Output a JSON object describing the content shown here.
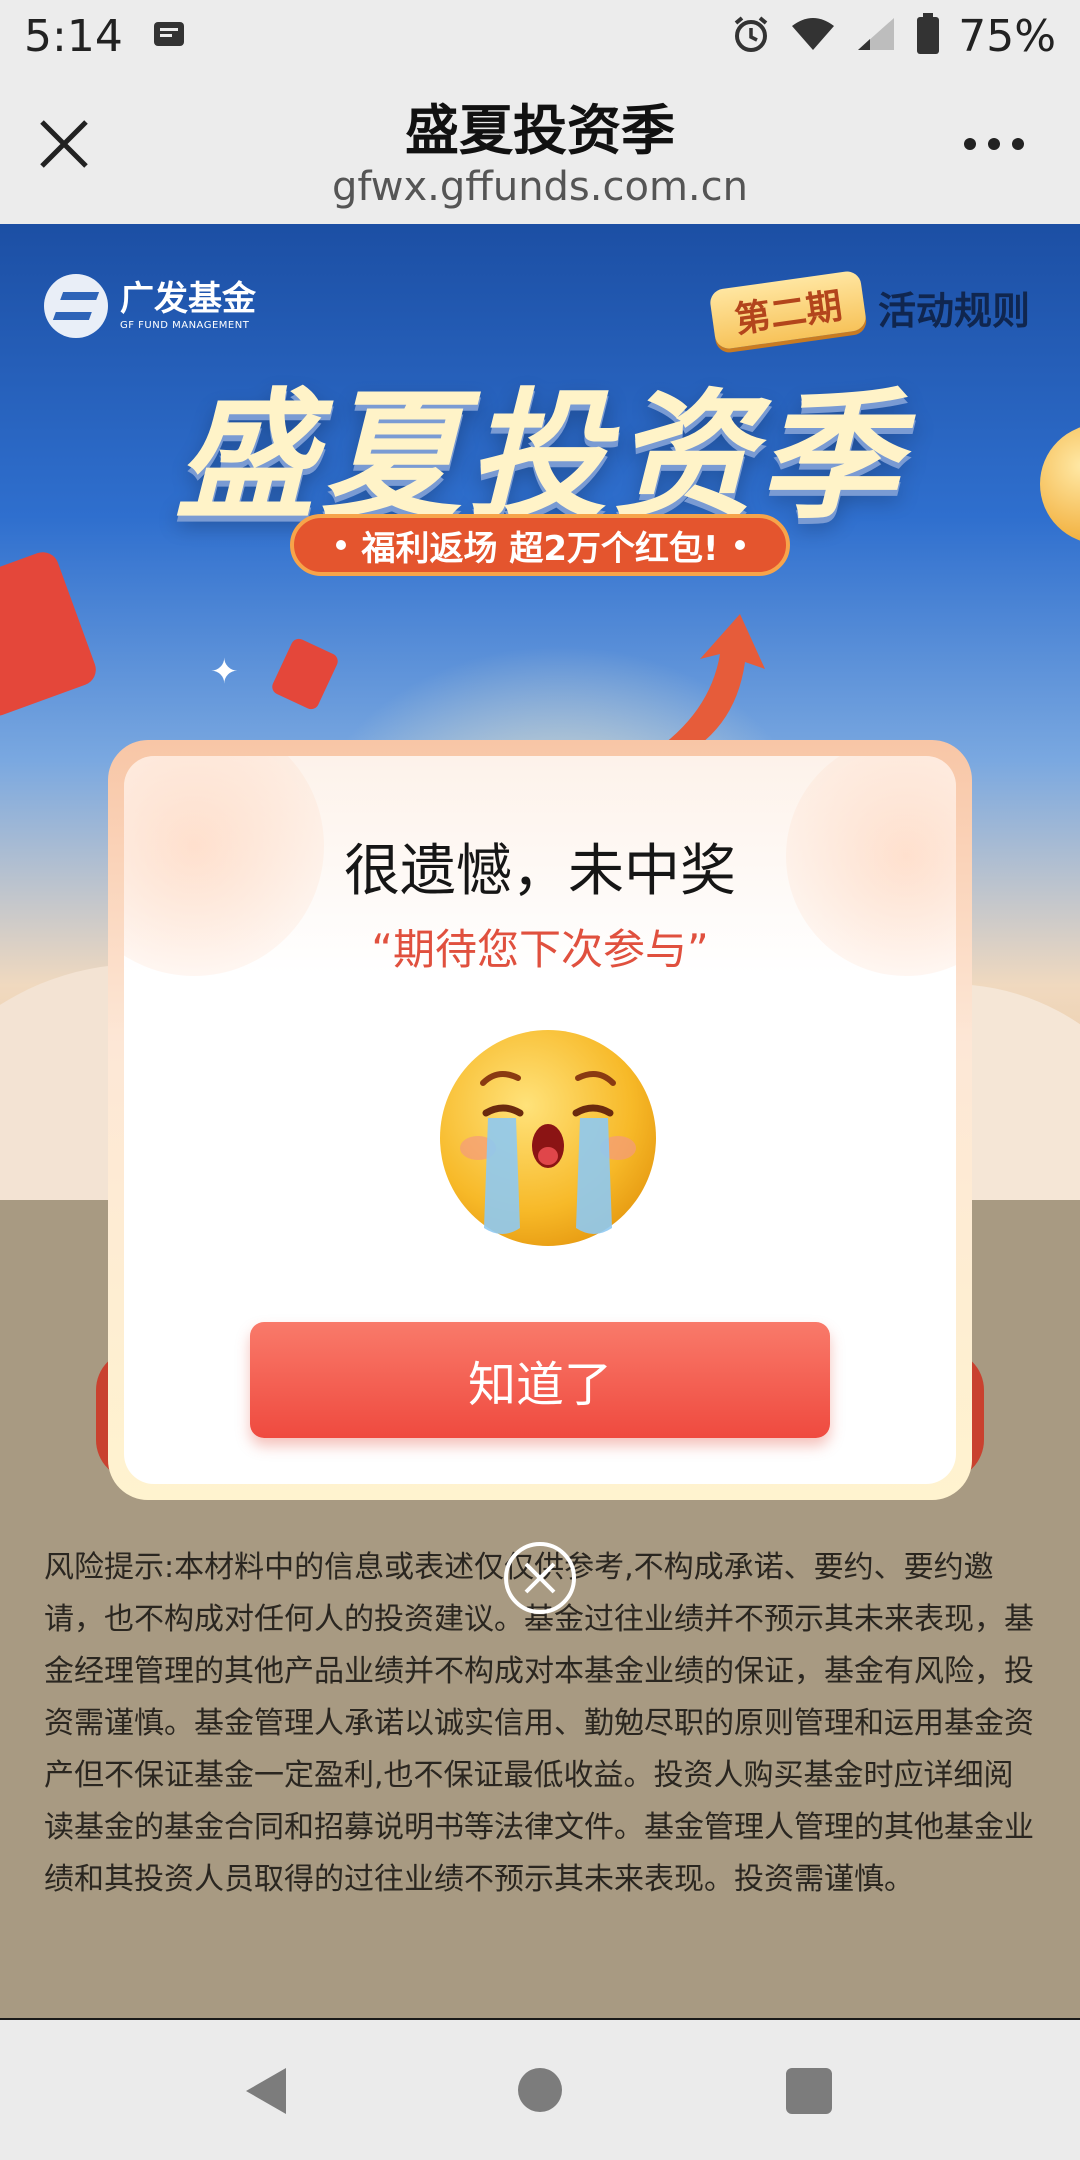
{
  "status_bar": {
    "time": "5:14",
    "battery": "75%"
  },
  "browser": {
    "title": "盛夏投资季",
    "url": "gfwx.gffunds.com.cn"
  },
  "banner": {
    "logo_cn": "广发基金",
    "logo_en": "GF FUND MANAGEMENT",
    "phase_tag": "第二期",
    "rules_link": "活动规则",
    "title": "盛夏投资季",
    "pill": "福利返场 超2万个红包!"
  },
  "risk_notice": "风险提示:本材料中的信息或表述仅仅供参考,不构成承诺、要约、要约邀请，也不构成对任何人的投资建议。基金过往业绩并不预示其未来表现，基金经理管理的其他产品业绩并不构成对本基金业绩的保证，基金有风险，投资需谨慎。基金管理人承诺以诚实信用、勤勉尽职的原则管理和运用基金资产但不保证基金一定盈利,也不保证最低收益。投资人购买基金时应详细阅读基金的基金合同和招募说明书等法律文件。基金管理人管理的其他基金业绩和其投资人员取得的过往业绩不预示其未来表现。投资需谨慎。",
  "modal": {
    "title": "很遗憾，未中奖",
    "subtitle": "“期待您下次参与”",
    "button": "知道了",
    "emoji_icon": "crying-face-icon",
    "close_icon": "circle-close-icon"
  },
  "colors": {
    "accent_red": "#ef4a3f",
    "subtitle_red": "#e0503e",
    "banner_blue": "#2f6fce"
  }
}
